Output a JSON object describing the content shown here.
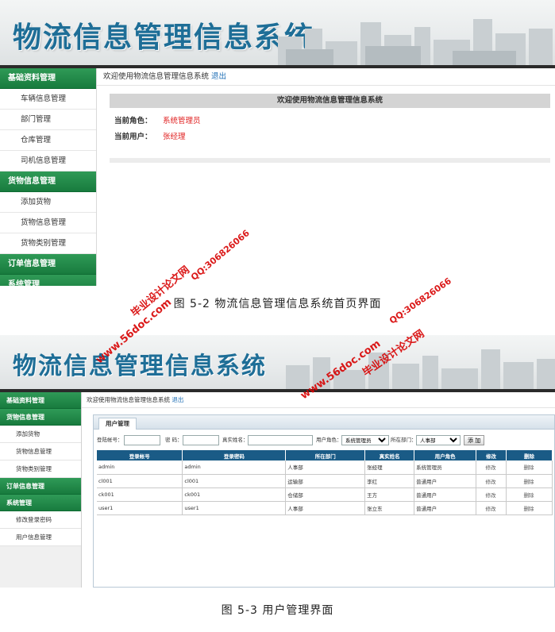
{
  "system_title": "物流信息管理信息系统",
  "shot1": {
    "sidebar": [
      {
        "type": "head",
        "label": "基础资料管理"
      },
      {
        "type": "item",
        "label": "车辆信息管理"
      },
      {
        "type": "item",
        "label": "部门管理"
      },
      {
        "type": "item",
        "label": "仓库管理"
      },
      {
        "type": "item",
        "label": "司机信息管理"
      },
      {
        "type": "head",
        "label": "货物信息管理"
      },
      {
        "type": "item",
        "label": "添加货物"
      },
      {
        "type": "item",
        "label": "货物信息管理"
      },
      {
        "type": "item",
        "label": "货物类别管理"
      },
      {
        "type": "head",
        "label": "订单信息管理"
      },
      {
        "type": "head",
        "label": "系统管理"
      }
    ],
    "welcome_text": "欢迎使用物流信息管理信息系统",
    "logout": "退出",
    "welcome_box": "欢迎使用物流信息管理信息系统",
    "role_label": "当前角色：",
    "role_value": "系统管理员",
    "user_label": "当前用户：",
    "user_value": "张经理"
  },
  "caption1": "图 5-2 物流信息管理信息系统首页界面",
  "shot2": {
    "sidebar": [
      {
        "type": "head",
        "label": "基础资料管理"
      },
      {
        "type": "head",
        "label": "货物信息管理"
      },
      {
        "type": "item",
        "label": "添加货物"
      },
      {
        "type": "item",
        "label": "货物信息管理"
      },
      {
        "type": "item",
        "label": "货物类别管理"
      },
      {
        "type": "head",
        "label": "订单信息管理"
      },
      {
        "type": "head",
        "label": "系统管理"
      },
      {
        "type": "item",
        "label": "修改登录密码"
      },
      {
        "type": "item",
        "label": "用户信息管理"
      }
    ],
    "welcome_text": "欢迎使用物流信息管理信息系统",
    "logout": "退出",
    "tab": "用户管理",
    "filter": {
      "account_label": "登陆帐号：",
      "password_label": "密 码：",
      "realname_label": "真实姓名：",
      "role_label": "用户角色：",
      "role_value": "系统管理员",
      "dept_label": "所在部门：",
      "dept_value": "人事部",
      "add_button": "添 加"
    },
    "table": {
      "headers": [
        "登录帐号",
        "登录密码",
        "所在部门",
        "真实姓名",
        "用户角色",
        "修改",
        "删除"
      ],
      "rows": [
        [
          "admin",
          "admin",
          "人事部",
          "张经理",
          "系统管理员",
          "修改",
          "删除"
        ],
        [
          "cl001",
          "cl001",
          "运输部",
          "李红",
          "普通用户",
          "修改",
          "删除"
        ],
        [
          "ck001",
          "ck001",
          "仓储部",
          "王方",
          "普通用户",
          "修改",
          "删除"
        ],
        [
          "user1",
          "user1",
          "人事部",
          "张立东",
          "普通用户",
          "修改",
          "删除"
        ]
      ]
    }
  },
  "caption2": "图 5-3 用户管理界面",
  "watermarks": {
    "site": "www.56doc.com",
    "qq": "QQ:306826066",
    "brand": "毕业设计论文网"
  },
  "colors": {
    "title_blue": "#1e6e97",
    "sidebar_green": "#187b3e",
    "table_header": "#1a5b86",
    "value_red": "#e02020",
    "watermark_red": "#d70000"
  }
}
